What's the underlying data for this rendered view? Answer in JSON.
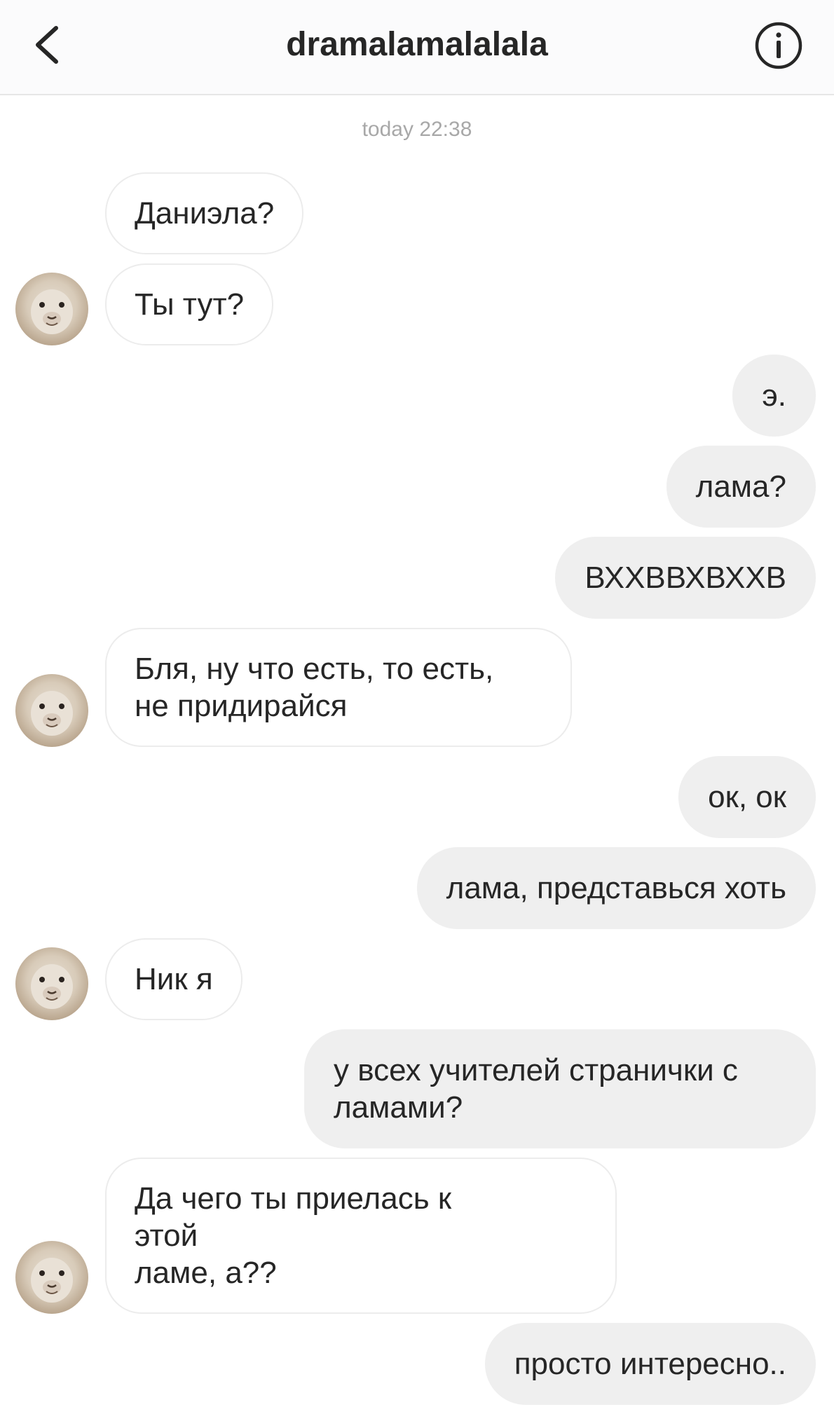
{
  "header": {
    "title": "dramalamalalala"
  },
  "timestamp": "today 22:38",
  "messages": [
    {
      "side": "in",
      "text": "Даниэла?"
    },
    {
      "side": "in",
      "text": "Ты тут?"
    },
    {
      "side": "out",
      "text": "э."
    },
    {
      "side": "out",
      "text": "лама?"
    },
    {
      "side": "out",
      "text": "ВХХВВХВХХВ"
    },
    {
      "side": "in",
      "text": "Бля, ну что есть, то есть,\nне придирайся"
    },
    {
      "side": "out",
      "text": "ок, ок"
    },
    {
      "side": "out",
      "text": "лама, представься хоть"
    },
    {
      "side": "in",
      "text": "Ник я"
    },
    {
      "side": "out",
      "text": "у всех учителей странички с ламами?"
    },
    {
      "side": "in",
      "text": "Да чего ты приелась к этой\nламе, а??"
    },
    {
      "side": "out",
      "text": "просто интересно.."
    }
  ]
}
